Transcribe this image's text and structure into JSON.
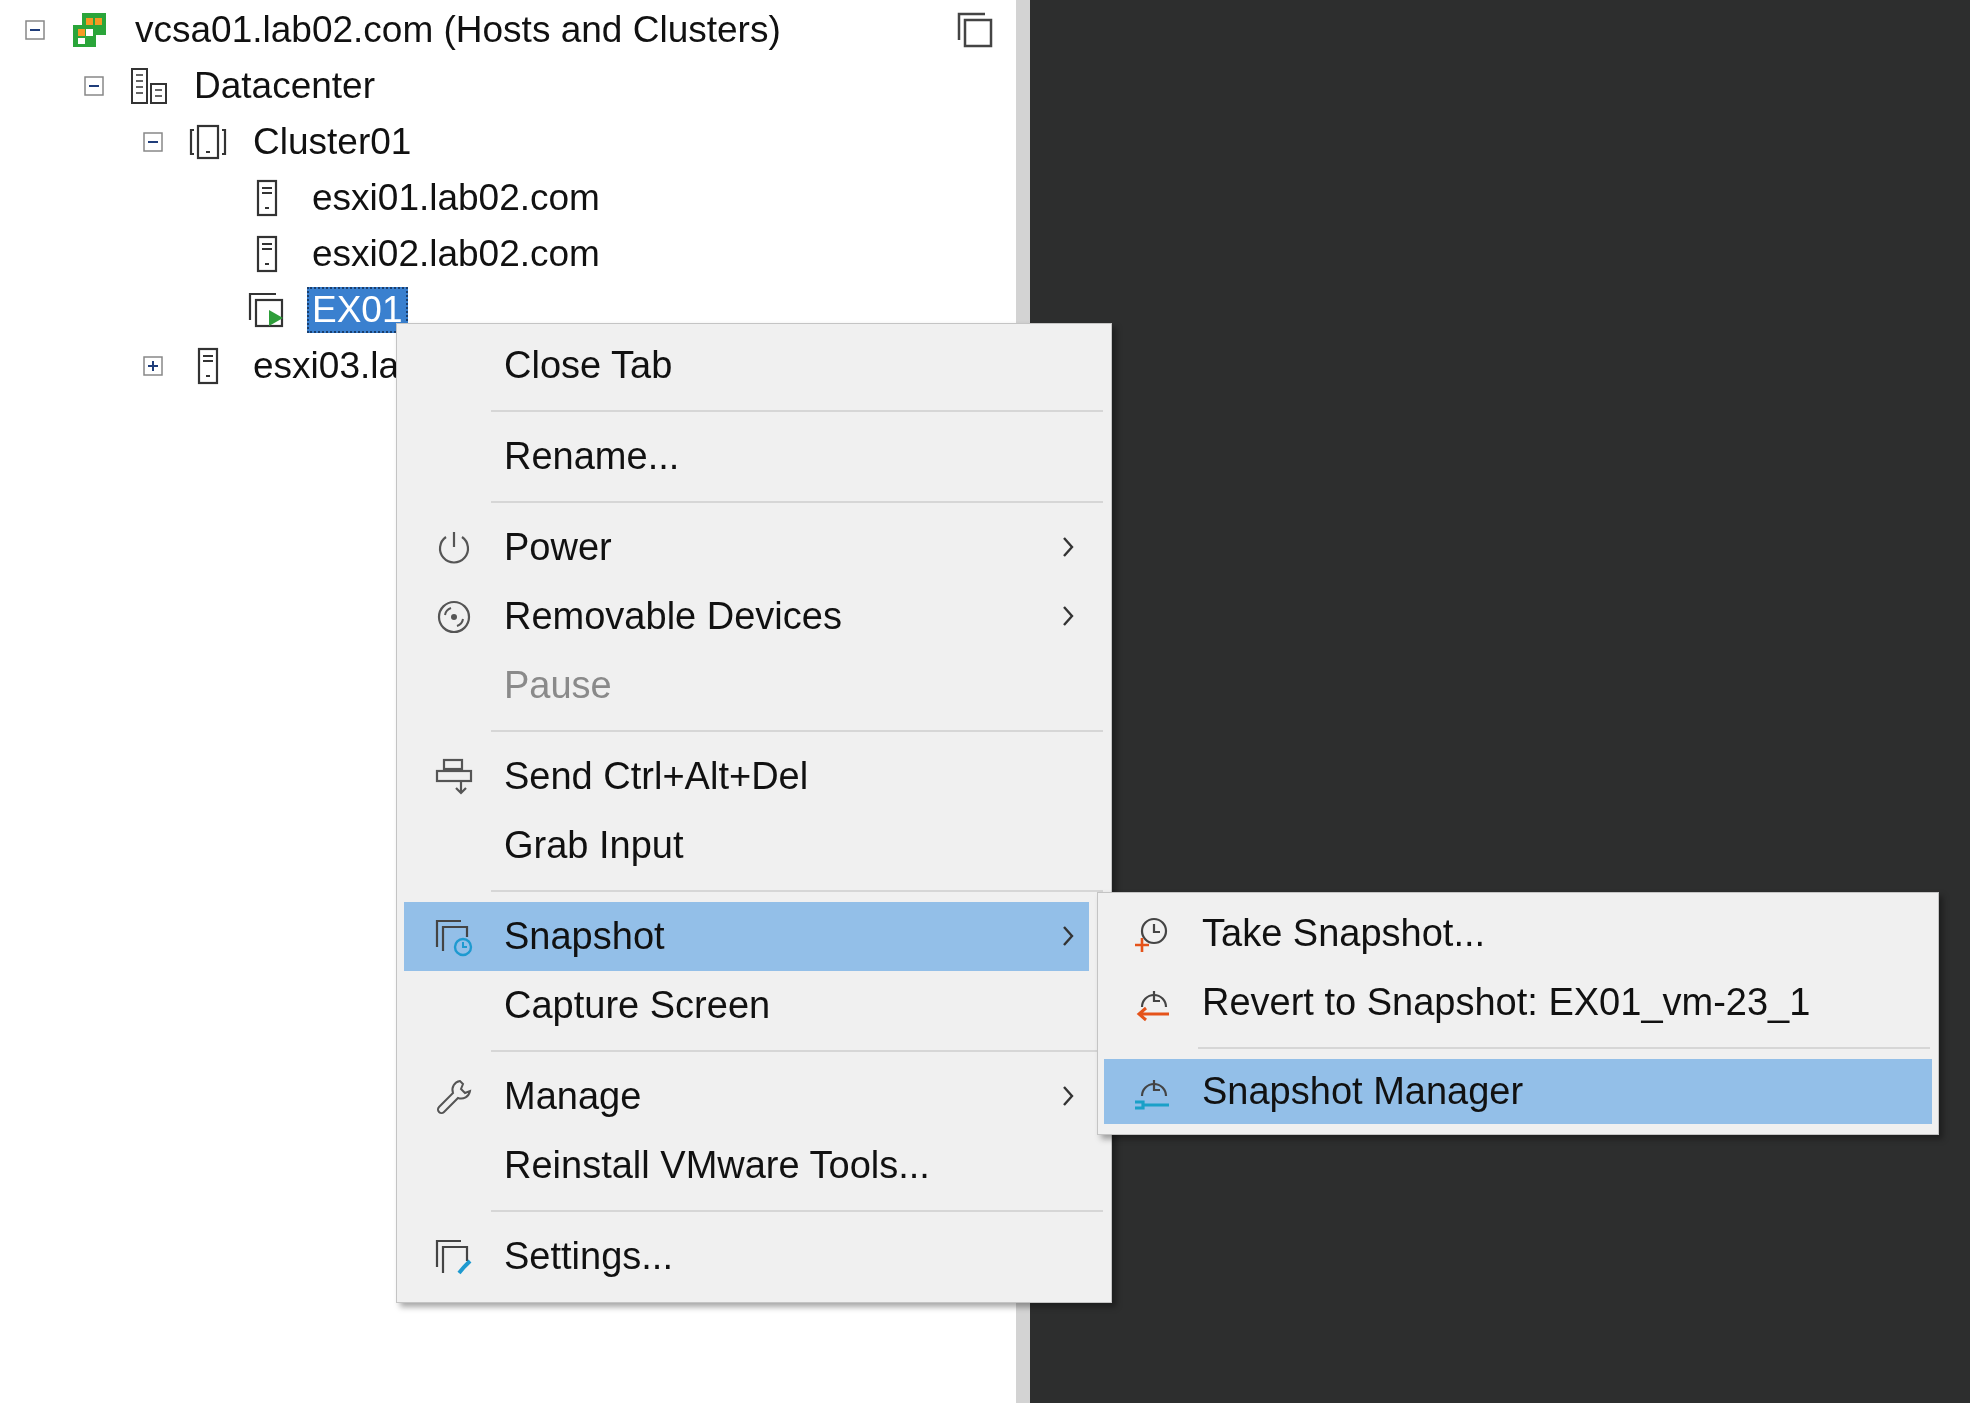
{
  "tree": {
    "nodes": [
      {
        "label": "vcsa01.lab02.com (Hosts and Clusters)",
        "kind": "vcenter",
        "expanded": true,
        "selected": false,
        "children": [
          {
            "label": "Datacenter",
            "kind": "datacenter",
            "expanded": true,
            "selected": false,
            "children": [
              {
                "label": "Cluster01",
                "kind": "cluster",
                "expanded": true,
                "selected": false,
                "children": [
                  {
                    "label": "esxi01.lab02.com",
                    "kind": "host",
                    "selected": false
                  },
                  {
                    "label": "esxi02.lab02.com",
                    "kind": "host",
                    "selected": false
                  },
                  {
                    "label": "EX01",
                    "kind": "vm",
                    "selected": true
                  }
                ]
              },
              {
                "label": "esxi03.la",
                "kind": "host",
                "expanded": false,
                "selected": false
              }
            ]
          }
        ]
      }
    ]
  },
  "context_menu": {
    "groups": [
      [
        {
          "label": "Close Tab",
          "kind": "none",
          "disabled": false,
          "has_submenu": false,
          "selected": false
        }
      ],
      [
        {
          "label": "Rename...",
          "kind": "none",
          "disabled": false,
          "has_submenu": false,
          "selected": false
        }
      ],
      [
        {
          "label": "Power",
          "kind": "power",
          "disabled": false,
          "has_submenu": true,
          "selected": false
        },
        {
          "label": "Removable Devices",
          "kind": "disc",
          "disabled": false,
          "has_submenu": true,
          "selected": false
        },
        {
          "label": "Pause",
          "kind": "none",
          "disabled": true,
          "has_submenu": false,
          "selected": false
        }
      ],
      [
        {
          "label": "Send Ctrl+Alt+Del",
          "kind": "keys",
          "disabled": false,
          "has_submenu": false,
          "selected": false
        },
        {
          "label": "Grab Input",
          "kind": "none",
          "disabled": false,
          "has_submenu": false,
          "selected": false
        }
      ],
      [
        {
          "label": "Snapshot",
          "kind": "snapshot",
          "disabled": false,
          "has_submenu": true,
          "selected": true
        },
        {
          "label": "Capture Screen",
          "kind": "none",
          "disabled": false,
          "has_submenu": false,
          "selected": false
        }
      ],
      [
        {
          "label": "Manage",
          "kind": "wrench",
          "disabled": false,
          "has_submenu": true,
          "selected": false
        },
        {
          "label": "Reinstall VMware Tools...",
          "kind": "none",
          "disabled": false,
          "has_submenu": false,
          "selected": false
        }
      ],
      [
        {
          "label": "Settings...",
          "kind": "settings",
          "disabled": false,
          "has_submenu": false,
          "selected": false
        }
      ]
    ]
  },
  "snapshot_submenu": {
    "groups": [
      [
        {
          "label": "Take Snapshot...",
          "kind": "take",
          "selected": false
        },
        {
          "label": "Revert to Snapshot: EX01_vm-23_1",
          "kind": "revert",
          "selected": false
        }
      ],
      [
        {
          "label": "Snapshot Manager",
          "kind": "manager",
          "selected": true
        }
      ]
    ]
  }
}
